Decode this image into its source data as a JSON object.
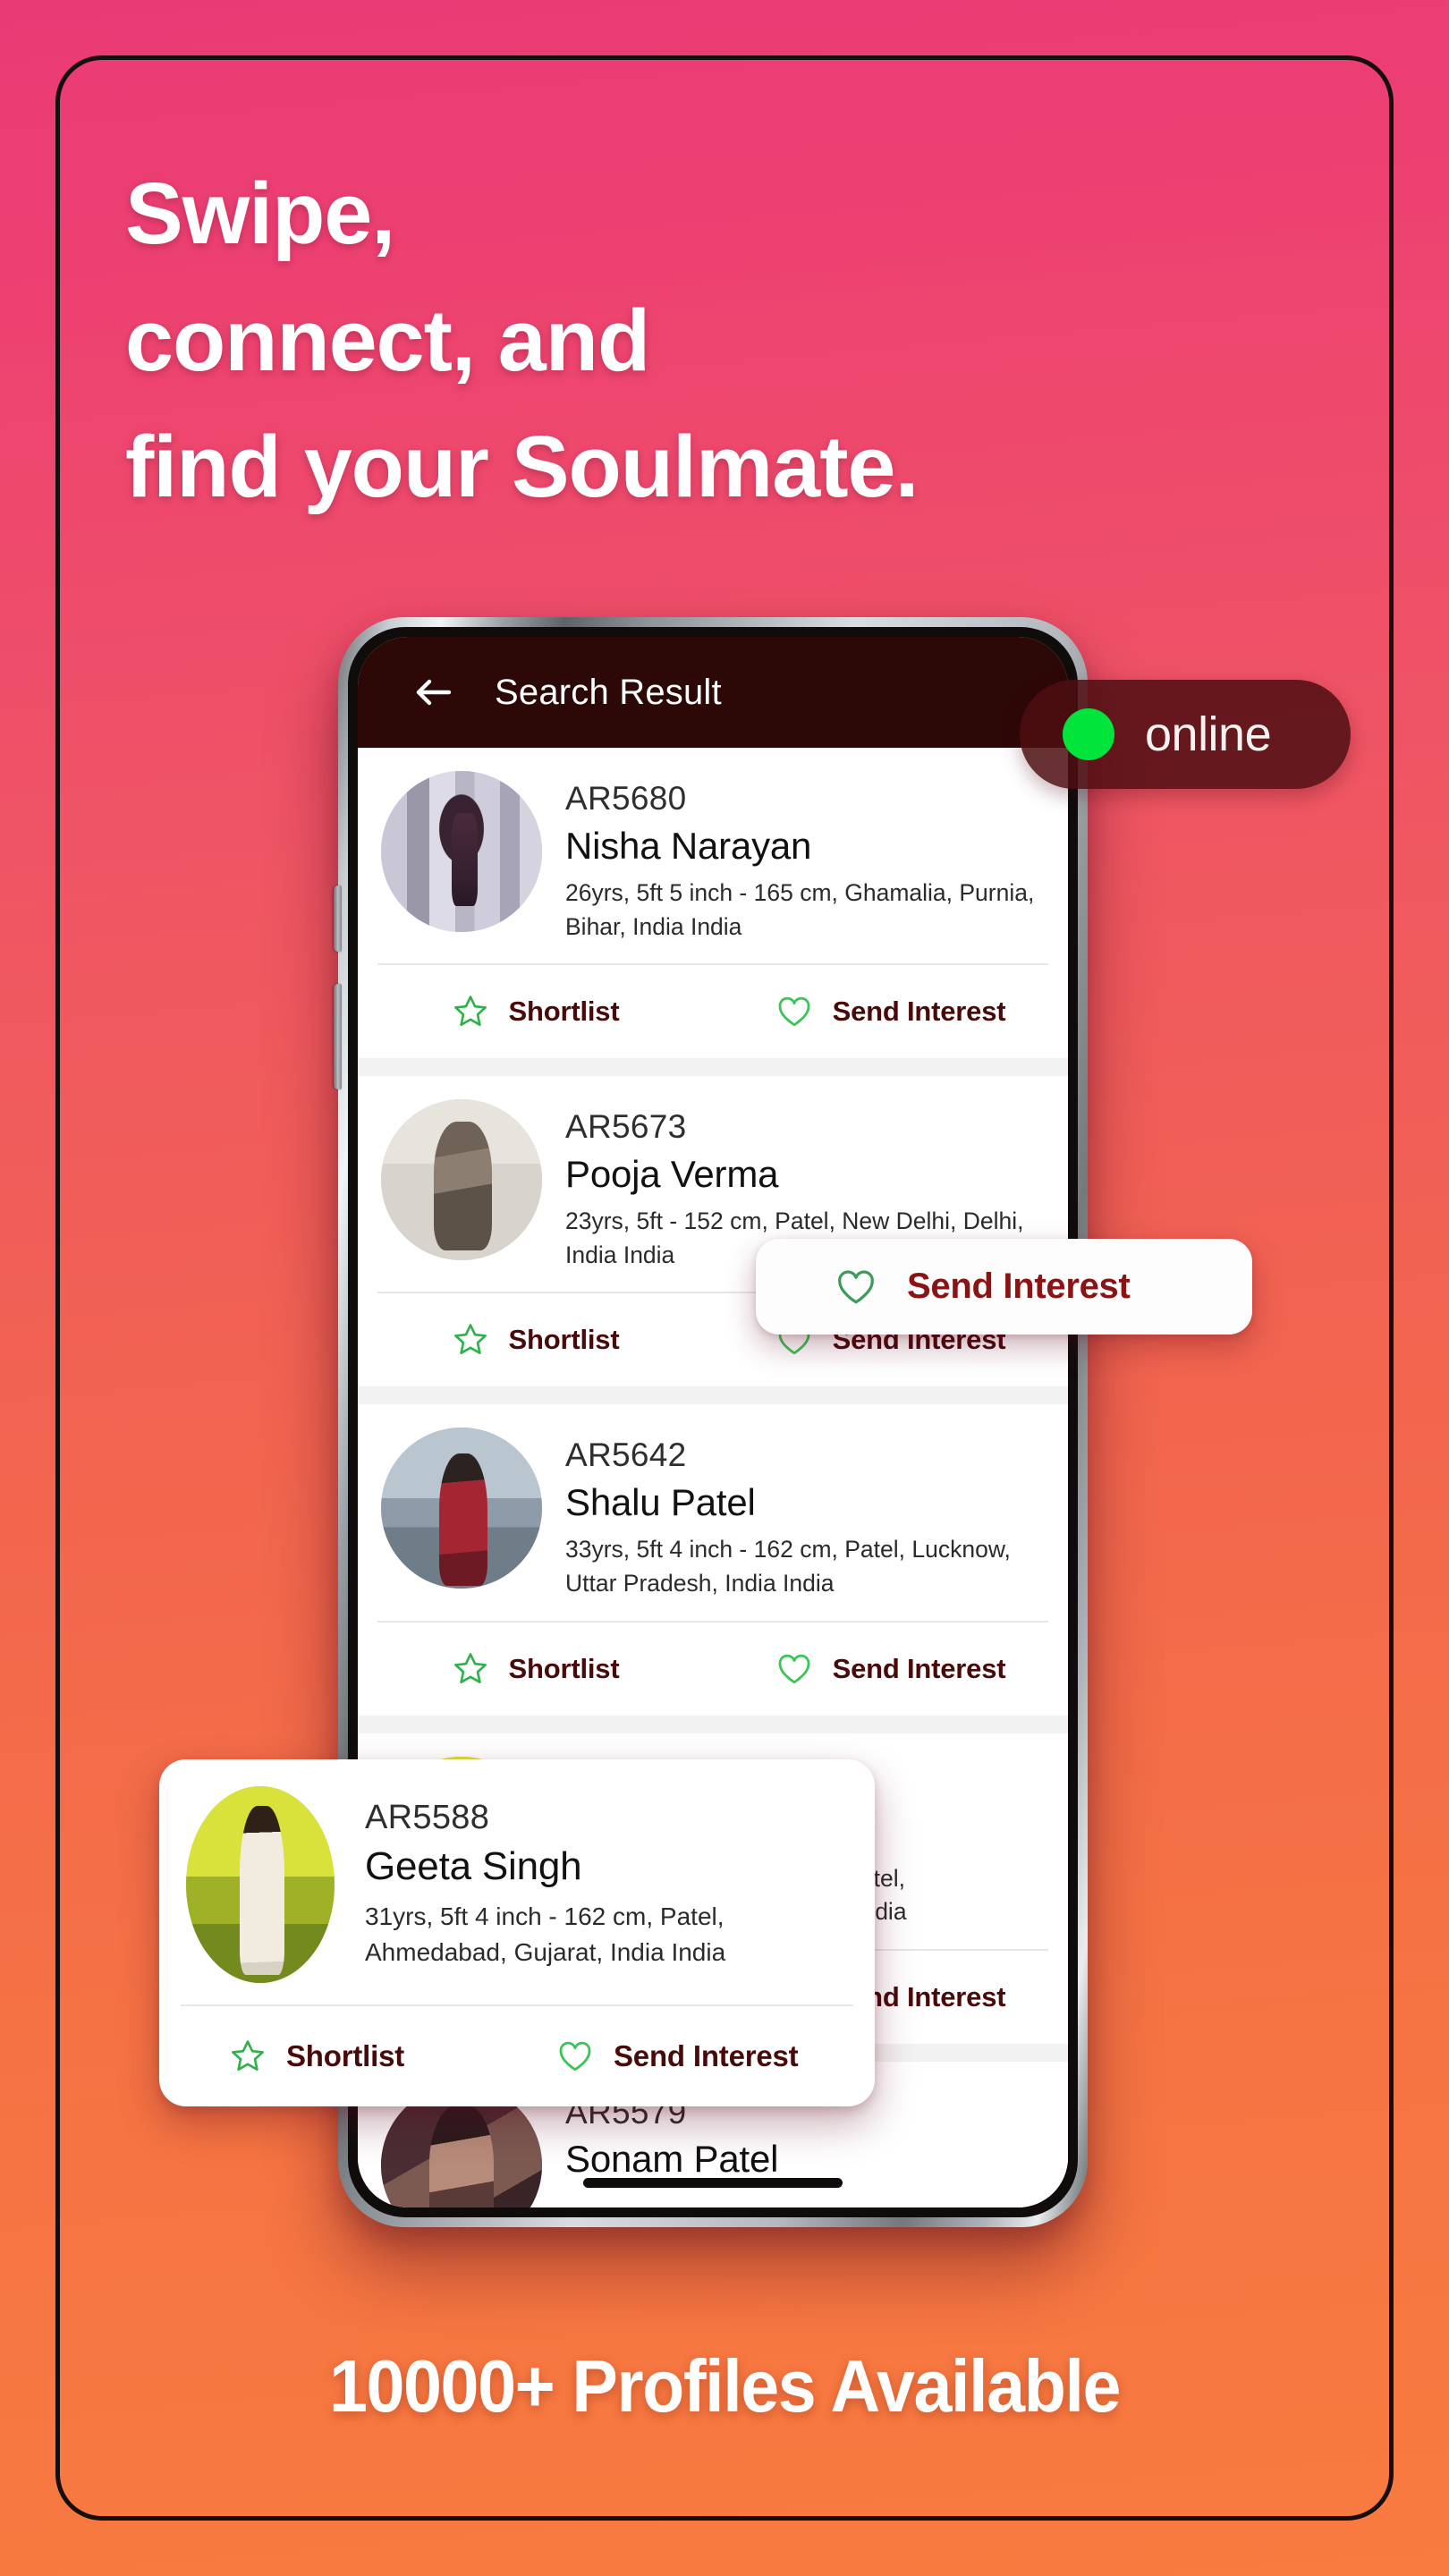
{
  "poster": {
    "headline": "Swipe,\nconnect, and\nfind your Soulmate.",
    "bottom_banner": "10000+ Profiles Available",
    "colors": {
      "gradient_top": "#ea3a76",
      "gradient_bottom": "#f87b3f",
      "app_bar": "#2c0807",
      "action_label": "#4b0a0a",
      "icon_green": "#2fb14a",
      "online_green": "#00e43c",
      "chip_label": "#8c1313"
    }
  },
  "online_badge": {
    "label": "online",
    "dot_icon": "online-dot-icon"
  },
  "app": {
    "app_bar": {
      "back_icon": "back-arrow-icon",
      "title": "Search Result"
    },
    "actions": {
      "shortlist_label": "Shortlist",
      "shortlist_icon": "star-outline-icon",
      "send_interest_label": "Send Interest",
      "send_interest_icon": "heart-outline-icon"
    },
    "profiles": [
      {
        "id": "AR5680",
        "name": "Nisha Narayan",
        "details": "26yrs, 5ft 5 inch - 165 cm, Ghamalia, Purnia, Bihar, India India",
        "avatar": "profile-photo-nisha"
      },
      {
        "id": "AR5673",
        "name": "Pooja Verma",
        "details": "23yrs, 5ft - 152 cm, Patel, New Delhi, Delhi, India India",
        "avatar": "profile-photo-pooja"
      },
      {
        "id": "AR5642",
        "name": "Shalu Patel",
        "details": "33yrs, 5ft 4 inch - 162 cm, Patel, Lucknow, Uttar Pradesh, India India",
        "avatar": "profile-photo-shalu"
      },
      {
        "id": "AR5588",
        "name": "Geeta Singh",
        "details": "31yrs, 5ft 4 inch - 162 cm, Patel, Ahmedabad, Gujarat, India India",
        "avatar": "profile-photo-geeta-behind"
      },
      {
        "id": "AR5579",
        "name": "Sonam Patel",
        "details": "",
        "avatar": "profile-photo-sonam"
      }
    ]
  },
  "floating_chip": {
    "label": "Send Interest",
    "icon": "heart-outline-icon"
  },
  "floating_card": {
    "id": "AR5588",
    "name": "Geeta Singh",
    "details": "31yrs, 5ft 4 inch - 162 cm, Patel, Ahmedabad, Gujarat, India India",
    "avatar": "profile-photo-geeta",
    "shortlist_label": "Shortlist",
    "send_interest_label": "Send Interest"
  }
}
